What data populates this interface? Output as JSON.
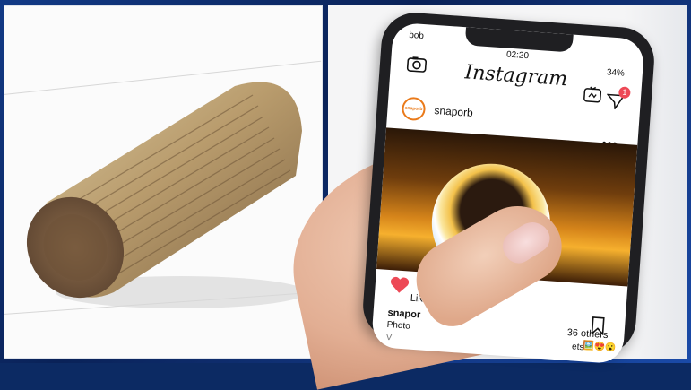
{
  "left_photo": {
    "subject": ""
  },
  "right_photo": {
    "phone": {
      "status": {
        "carrier": "bob",
        "time": "02:20",
        "battery": "34%"
      },
      "app_title": "Instagram",
      "notification_count": "1",
      "post": {
        "username": "snaporb",
        "avatar_text": "snaporb",
        "liked_prefix": "Liked b",
        "caption_user": "snapor",
        "caption_start": "Photo",
        "others": "36 others",
        "ets_fragment": "ets",
        "v_fragment": "V"
      }
    }
  },
  "colors": {
    "frame": "#123a86",
    "ig_heart": "#ed4956",
    "avatar_ring": "#ea7a1a"
  }
}
